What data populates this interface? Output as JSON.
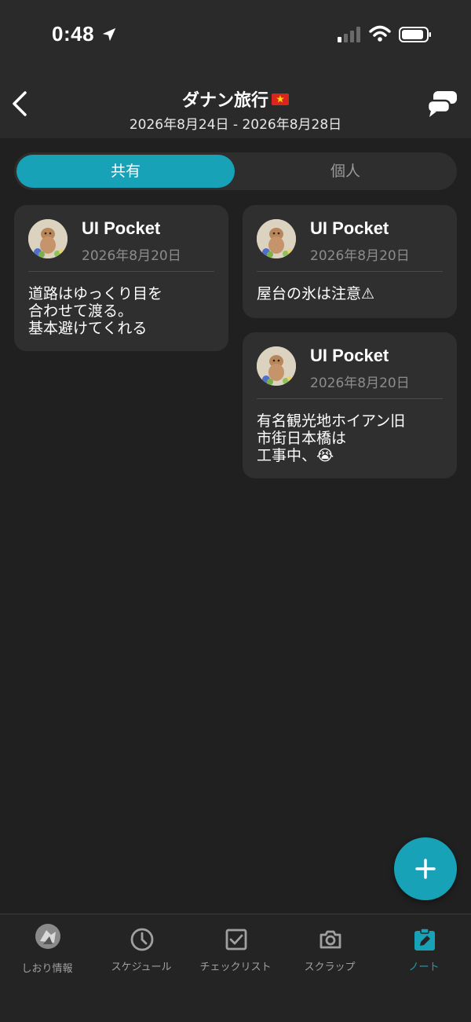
{
  "status_bar": {
    "time": "0:48"
  },
  "header": {
    "title": "ダナン旅行",
    "date_range": "2026年8月24日 - 2026年8月28日"
  },
  "segment": {
    "shared_label": "共有",
    "personal_label": "個人",
    "selected": "共有"
  },
  "notes": [
    {
      "author": "UI Pocket",
      "date": "2026年8月20日",
      "text": "道路はゆっくり目を\n合わせて渡る。\n基本避けてくれる"
    },
    {
      "author": "UI Pocket",
      "date": "2026年8月20日",
      "text": "屋台の氷は注意⚠"
    },
    {
      "author": "UI Pocket",
      "date": "2026年8月20日",
      "text": "有名観光地ホイアン旧\n市街日本橋は\n工事中、😭"
    }
  ],
  "tab_bar": {
    "items": [
      {
        "label": "しおり情報",
        "icon": "avatar-icon"
      },
      {
        "label": "スケジュール",
        "icon": "clock-icon"
      },
      {
        "label": "チェックリスト",
        "icon": "checkbox-icon"
      },
      {
        "label": "スクラップ",
        "icon": "camera-icon"
      },
      {
        "label": "ノート",
        "icon": "note-edit-icon"
      }
    ],
    "active": "ノート"
  },
  "colors": {
    "accent": "#17a2b8",
    "background": "#202020",
    "card": "#2f2f2f"
  }
}
